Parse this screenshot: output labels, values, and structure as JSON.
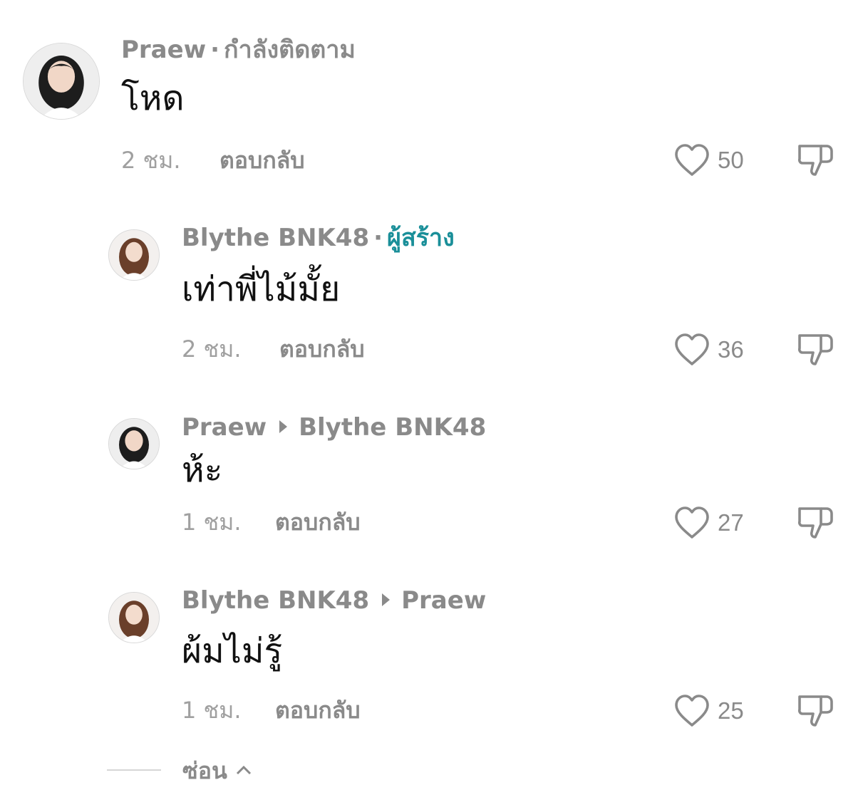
{
  "comments": [
    {
      "author": "Praew",
      "status": "กำลังติดตาม",
      "text": "โหด",
      "time": "2 ชม.",
      "reply_label": "ตอบกลับ",
      "likes": "50"
    },
    {
      "author": "Blythe BNK48",
      "creator_badge": "ผู้สร้าง",
      "text": "เท่าพี่ไม้มั้ย",
      "time": "2 ชม.",
      "reply_label": "ตอบกลับ",
      "likes": "36"
    },
    {
      "author": "Praew",
      "reply_to": "Blythe BNK48",
      "text": "ห้ะ",
      "time": "1 ชม.",
      "reply_label": "ตอบกลับ",
      "likes": "27"
    },
    {
      "author": "Blythe BNK48",
      "reply_to": "Praew",
      "text": "ผ้มไม่รู้",
      "time": "1 ชม.",
      "reply_label": "ตอบกลับ",
      "likes": "25"
    }
  ],
  "hide_replies": {
    "label": "ซ่อน"
  },
  "icons": {
    "like": "heart-outline-icon",
    "dislike": "thumbs-down-icon",
    "collapse": "chevron-up-icon",
    "reply_arrow": "caret-right-icon"
  },
  "colors": {
    "creator_badge": "#1a8f99",
    "meta_text": "#8a8a8a",
    "body_text": "#111111"
  }
}
